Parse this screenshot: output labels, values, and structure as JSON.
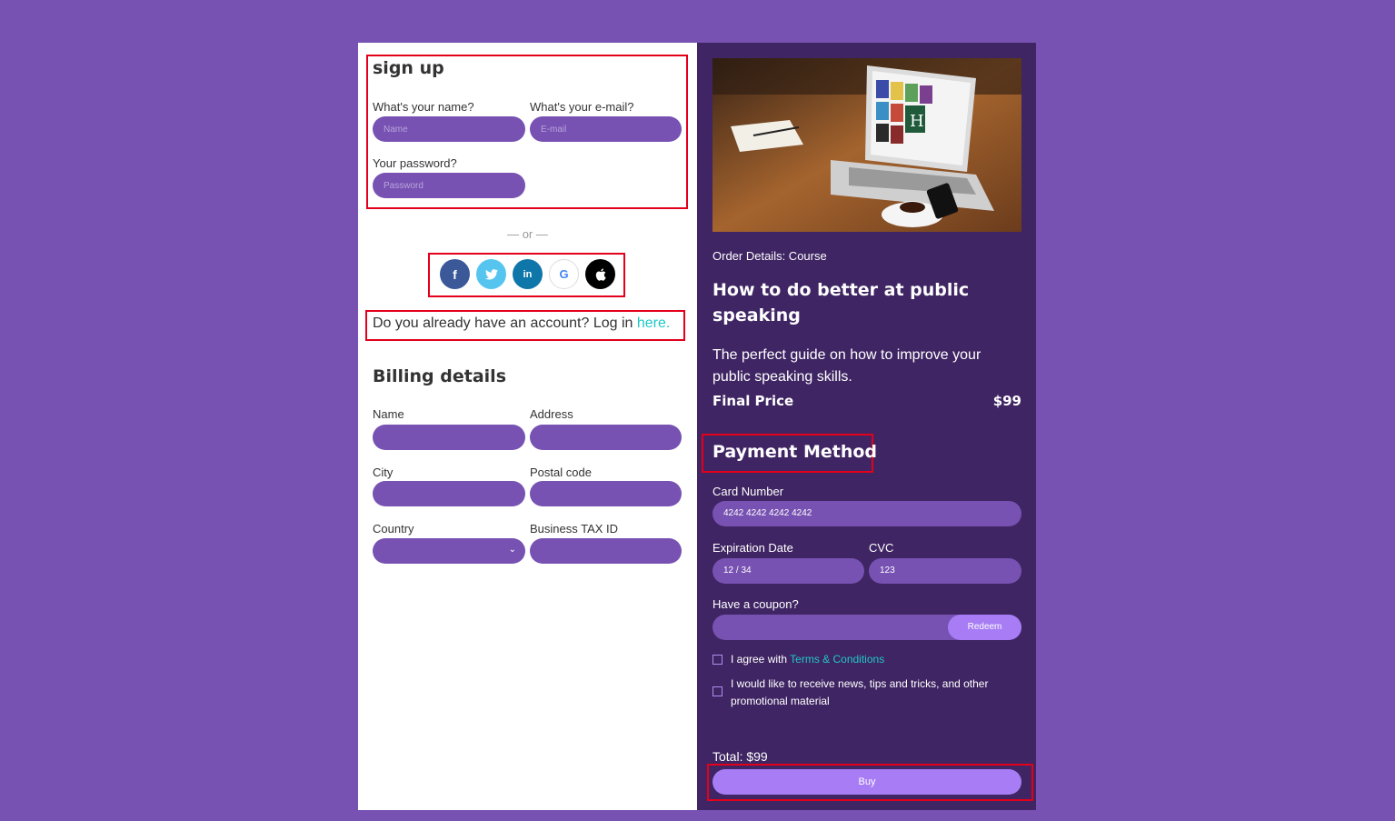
{
  "signup": {
    "title": "sign up",
    "name_label": "What's your name?",
    "name_placeholder": "Name",
    "email_label": "What's your e-mail?",
    "email_placeholder": "E-mail",
    "password_label": "Your password?",
    "password_placeholder": "Password",
    "or_text": "— or —",
    "social": [
      "facebook",
      "twitter",
      "linkedin",
      "google",
      "apple"
    ],
    "login_prompt": "Do you already have an account? Log in ",
    "login_link": "here."
  },
  "billing": {
    "title": "Billing details",
    "name_label": "Name",
    "address_label": "Address",
    "city_label": "City",
    "postal_label": "Postal code",
    "country_label": "Country",
    "tax_label": "Business TAX ID"
  },
  "order": {
    "details_label": "Order Details: Course",
    "course_title": "How to do better at public speaking",
    "description": "The perfect guide on how to improve your public speaking skills.",
    "final_price_label": "Final Price",
    "final_price": "$99"
  },
  "payment": {
    "title": "Payment Method",
    "card_label": "Card Number",
    "card_value": "4242 4242 4242 4242",
    "expiry_label": "Expiration Date",
    "expiry_value": "12 / 34",
    "cvc_label": "CVC",
    "cvc_value": "123",
    "coupon_label": "Have a coupon?",
    "redeem_label": "Redeem",
    "terms_prefix": "I agree with ",
    "terms_link": "Terms & Conditions",
    "news_label": "I would like to receive news, tips and tricks, and other promotional material",
    "total": "Total: $99",
    "buy_label": "Buy"
  },
  "colors": {
    "page_bg": "#7752b2",
    "panel_dark": "#3f2563",
    "accent": "#7752b2",
    "button": "#a77cf5",
    "link": "#22c7c7",
    "highlight": "#e3001b"
  }
}
